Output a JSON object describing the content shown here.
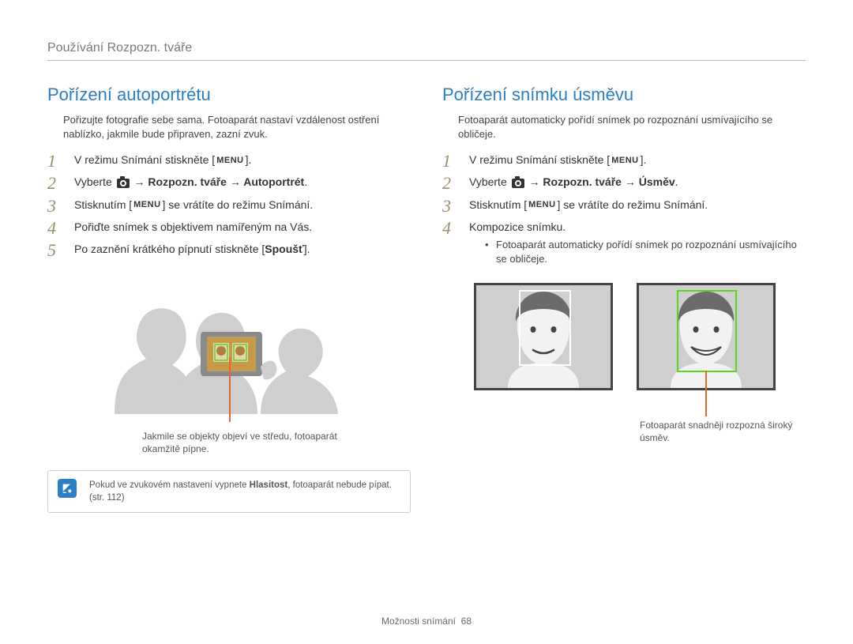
{
  "breadcrumb": "Používání Rozpozn. tváře",
  "left": {
    "title": "Pořízení autoportrétu",
    "intro": "Pořizujte fotografie sebe sama. Fotoaparát nastaví vzdálenost ostření nablízko, jakmile bude připraven, zazní zvuk.",
    "steps": {
      "s1_pre": "V režimu Snímání stiskněte [",
      "s1_menu": "MENU",
      "s1_post": "].",
      "s2_pre": "Vyberte ",
      "s2_bold": " → Rozpozn. tváře → Autoportrét",
      "s2_post": ".",
      "s3_pre": "Stisknutím [",
      "s3_menu": "MENU",
      "s3_post": "] se vrátíte do režimu Snímání.",
      "s4": "Pořiďte snímek s objektivem namířeným na Vás.",
      "s5_pre": "Po zaznění krátkého pípnutí stiskněte [",
      "s5_bold": "Spoušť",
      "s5_post": "]."
    },
    "caption": "Jakmile se objekty objeví ve středu, fotoaparát okamžitě pípne.",
    "note_pre": "Pokud ve zvukovém nastavení vypnete ",
    "note_bold": "Hlasitost",
    "note_post": ", fotoaparát nebude pípat. (str. 112)"
  },
  "right": {
    "title": "Pořízení snímku úsměvu",
    "intro": "Fotoaparát automaticky pořídí snímek po rozpoznání usmívajícího se obličeje.",
    "steps": {
      "s1_pre": "V režimu Snímání stiskněte [",
      "s1_menu": "MENU",
      "s1_post": "].",
      "s2_pre": "Vyberte ",
      "s2_bold": " → Rozpozn. tváře → Úsměv",
      "s2_post": ".",
      "s3_pre": "Stisknutím [",
      "s3_menu": "MENU",
      "s3_post": "] se vrátíte do režimu Snímání.",
      "s4": "Kompozice snímku.",
      "s4_bullet": "Fotoaparát automaticky pořídí snímek po rozpoznání usmívajícího se obličeje."
    },
    "caption": "Fotoaparát snadněji rozpozná široký úsměv."
  },
  "footer_label": "Možnosti snímání",
  "footer_page": "68"
}
